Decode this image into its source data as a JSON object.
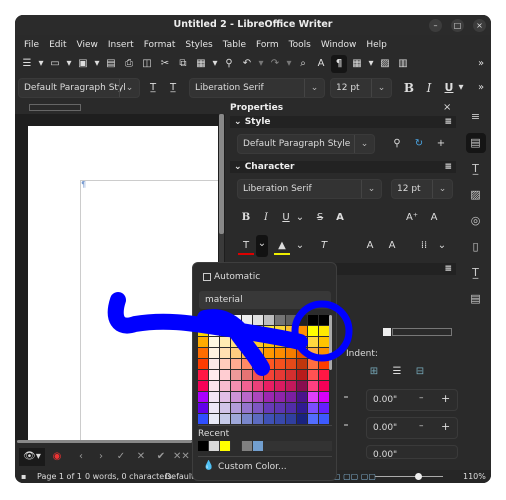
{
  "window": {
    "title": "Untitled 2 - LibreOffice Writer",
    "controls": [
      "minimize",
      "maximize",
      "close"
    ]
  },
  "menu": [
    "File",
    "Edit",
    "View",
    "Insert",
    "Format",
    "Styles",
    "Table",
    "Form",
    "Tools",
    "Window",
    "Help"
  ],
  "toolbar2": {
    "paragraph_style": "Default Paragraph Styl",
    "font": "Liberation Serif",
    "size": "12 pt",
    "bold": "B",
    "italic": "I",
    "underline": "U"
  },
  "sidebar": {
    "title": "Properties",
    "style_section": "Style",
    "style_value": "Default Paragraph Style",
    "character_section": "Character",
    "font": "Liberation Serif",
    "size": "12 pt",
    "indent_label": "Indent:",
    "spin_values": [
      "0.00\"",
      "0.00\"",
      "0.00\""
    ]
  },
  "popup": {
    "automatic_label": "Automatic",
    "palette": "material",
    "recent_label": "Recent",
    "custom_color_label": "Custom Color...",
    "recent_colors": [
      "#000000",
      "#d8d8d8",
      "#ffff00",
      "#2c2c2c",
      "#808080",
      "#729fcf"
    ],
    "colors": [
      [
        "#9e9e9e",
        "#ffffff",
        "#fafafa",
        "#f5f5f5",
        "#eeeeee",
        "#e0e0e0",
        "#bdbdbd",
        "#757575",
        "#616161",
        "#212121",
        "#000000",
        "#000000"
      ],
      [
        "#ffd600",
        "#fffde7",
        "#fff9c4",
        "#fff59d",
        "#fff176",
        "#ffee58",
        "#ffeb3b",
        "#fdd835",
        "#fbc02d",
        "#ff8f00",
        "#ffff00",
        "#ffea00"
      ],
      [
        "#ffab00",
        "#fff8e1",
        "#ffecb3",
        "#ffe082",
        "#ffd54f",
        "#ffca28",
        "#ffc107",
        "#ffb300",
        "#ffa000",
        "#ff6f00",
        "#ffd740",
        "#ffc400"
      ],
      [
        "#ff6d00",
        "#fff3e0",
        "#ffe0b2",
        "#ffcc80",
        "#ffb74d",
        "#ffa726",
        "#ff9800",
        "#fb8c00",
        "#f57c00",
        "#e65100",
        "#ffab40",
        "#ff9100"
      ],
      [
        "#ff3d00",
        "#fbe9e7",
        "#ffccbc",
        "#ffab91",
        "#ff8a65",
        "#ff7043",
        "#ff5722",
        "#f4511e",
        "#e64a19",
        "#bf360c",
        "#ff6e40",
        "#ff3d00"
      ],
      [
        "#ff1744",
        "#ffebee",
        "#ffcdd2",
        "#ef9a9a",
        "#e57373",
        "#ef5350",
        "#f44336",
        "#e53935",
        "#d32f2f",
        "#b71c1c",
        "#ff5252",
        "#ff1744"
      ],
      [
        "#f50057",
        "#fce4ec",
        "#f8bbd0",
        "#f48fb1",
        "#f06292",
        "#ec407a",
        "#e91e63",
        "#d81b60",
        "#c2185b",
        "#880e4f",
        "#ff4081",
        "#f50057"
      ],
      [
        "#aa00ff",
        "#f3e5f5",
        "#e1bee7",
        "#ce93d8",
        "#ba68c8",
        "#ab47bc",
        "#9c27b0",
        "#8e24aa",
        "#7b1fa2",
        "#4a148c",
        "#e040fb",
        "#d500f9"
      ],
      [
        "#6200ea",
        "#ede7f6",
        "#d1c4e9",
        "#b39ddb",
        "#9575cd",
        "#7e57c2",
        "#673ab7",
        "#5e35b1",
        "#512da8",
        "#311b92",
        "#7c4dff",
        "#651fff"
      ],
      [
        "#304ffe",
        "#e8eaf6",
        "#c5cae9",
        "#9fa8da",
        "#7986cb",
        "#5c6bc0",
        "#3f51b5",
        "#3949ab",
        "#303f9f",
        "#1a237e",
        "#536dfe",
        "#3d5afe"
      ]
    ]
  },
  "statusbar": {
    "page": "Page 1 of 1",
    "words": "0 words, 0 characters",
    "style": "Default ...",
    "zoom": "110%"
  },
  "annotation_color": "#0000ff"
}
